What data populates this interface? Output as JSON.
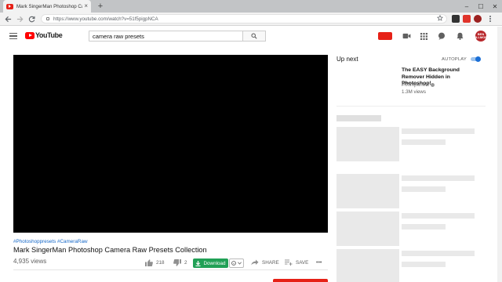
{
  "browser": {
    "tab_title": "Mark SingerMan Photoshop Car",
    "tab_close": "×",
    "new_tab": "+",
    "url": "https://www.youtube.com/watch?v=51f5pigpNCA",
    "window_controls": [
      "–",
      "☐",
      "✕"
    ]
  },
  "youtube": {
    "logo_text": "YouTube",
    "search_query": "camera raw presets",
    "avatar_text": "BEN WILLMORE"
  },
  "video": {
    "hashtags": "#Photoshoppresets #CameraRaw",
    "title": "Mark SingerMan Photoshop Camera Raw Presets Collection",
    "views": "4,935 views",
    "likes": "218",
    "dislikes": "2",
    "download_label": "Download",
    "share_label": "SHARE",
    "save_label": "SAVE",
    "more_label": "•••"
  },
  "sidebar": {
    "up_next": "Up next",
    "autoplay": "AUTOPLAY",
    "autoplay_on": true,
    "first_video": {
      "title": "The EASY Background Remover Hidden in Photoshop!",
      "channel": "PiXimperfect",
      "views": "1.3M views"
    }
  },
  "colors": {
    "youtube_red": "#ff0000",
    "download_green": "#21a056",
    "link_blue": "#1668c8",
    "toggle_blue": "#1b6fd6"
  }
}
